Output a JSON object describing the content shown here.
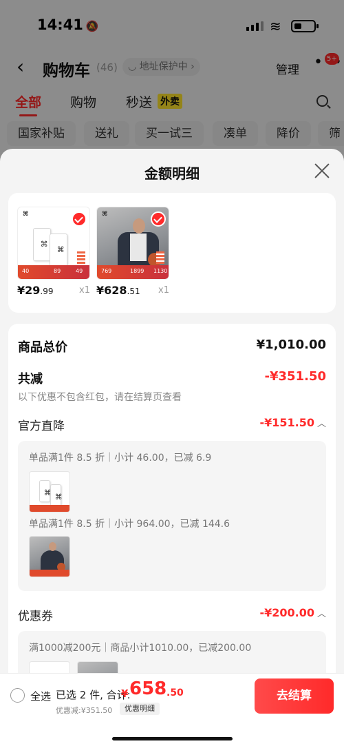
{
  "status": {
    "time": "14:41"
  },
  "nav": {
    "title": "购物车",
    "count": "(46)",
    "address_label": "地址保护中",
    "manage": "管理",
    "badge": "5+"
  },
  "tabs": [
    {
      "label": "全部"
    },
    {
      "label": "购物"
    },
    {
      "label": "秒送"
    }
  ],
  "tab_tag": "外卖",
  "chips": [
    "国家补贴",
    "送礼",
    "买一试三",
    "凑单",
    "降价",
    "筛选"
  ],
  "sheet": {
    "title": "金额明细",
    "products": [
      {
        "price_int": "¥29",
        "price_dec": ".99",
        "qty": "x1",
        "strip": [
          "40",
          "89",
          "49"
        ]
      },
      {
        "price_int": "¥628",
        "price_dec": ".51",
        "qty": "x1",
        "strip": [
          "769",
          "1899",
          "1130"
        ]
      }
    ],
    "summary": {
      "total_label": "商品总价",
      "total_value": "¥1,010.00",
      "discount_label": "共减",
      "discount_value": "-¥351.50",
      "note": "以下优惠不包含红包，请在结算页查看"
    },
    "official": {
      "label": "官方直降",
      "value": "-¥151.50",
      "lines": [
        "单品满1件 8.5 折｜小计 46.00，已减 6.9",
        "单品满1件 8.5 折｜小计 964.00，已减 144.6"
      ]
    },
    "coupon": {
      "label": "优惠券",
      "value": "-¥200.00",
      "line": "满1000减200元｜商品小计1010.00，已减200.00"
    }
  },
  "bottom": {
    "select_all": "全选",
    "selected_text": "已选 2 件, 合计:",
    "total_symbol": "¥",
    "total_int": "658",
    "total_dec": ".50",
    "saved": "优惠减:¥351.50",
    "detail_button": "优惠明细",
    "checkout": "去结算"
  },
  "colors": {
    "accent": "#ff2a2a",
    "sheet_bg": "#f4f4f4"
  }
}
